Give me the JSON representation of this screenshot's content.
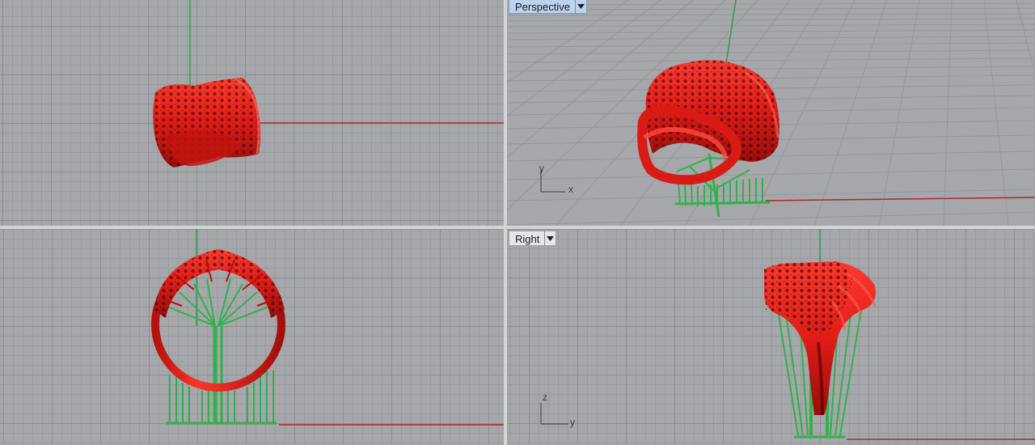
{
  "viewports": {
    "top": {
      "name": ""
    },
    "perspective": {
      "name": "Perspective",
      "active": true,
      "axis_x": "x",
      "axis_y": "y"
    },
    "front": {
      "name": ""
    },
    "right": {
      "name": "Right",
      "axis_x": "y",
      "axis_y": "z"
    }
  },
  "icons": {
    "dropdown": "chevron-down-icon"
  },
  "colors": {
    "model": "#e8211c",
    "supports": "#2fb24a",
    "x_axis": "#b0272a",
    "y_axis": "#23a14a",
    "grid_bg": "#a5a7aa",
    "active_label": "#bcd3ef"
  }
}
